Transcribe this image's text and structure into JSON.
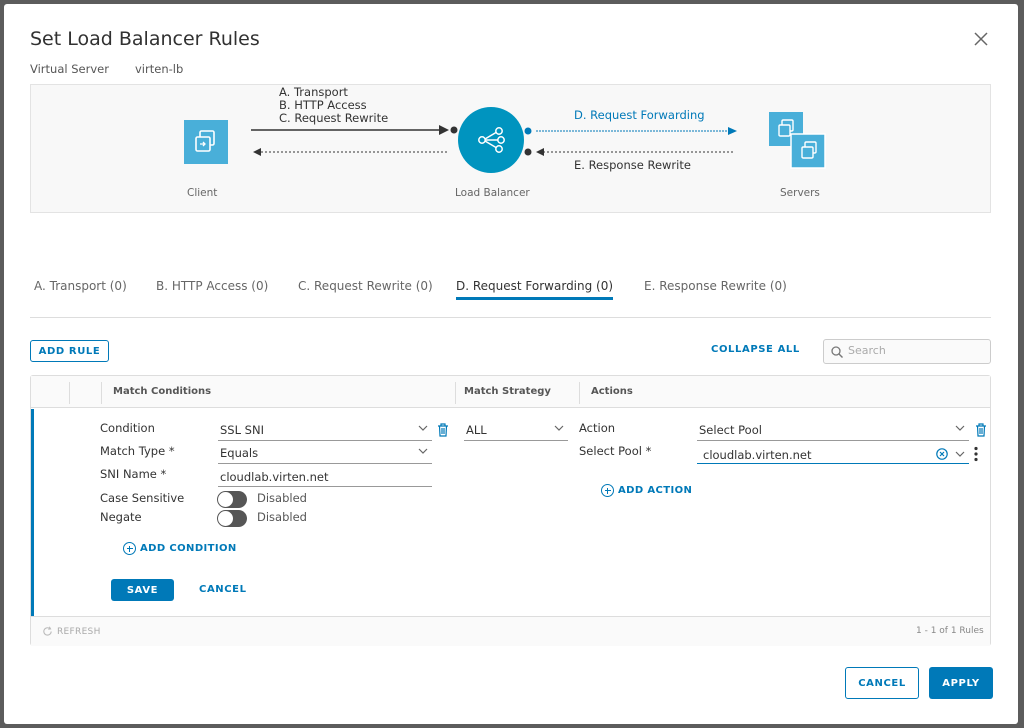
{
  "dialog": {
    "title": "Set Load Balancer Rules",
    "virtual_server_label": "Virtual Server",
    "virtual_server_value": "virten-lb"
  },
  "diagram": {
    "client_label": "Client",
    "lb_label": "Load Balancer",
    "servers_label": "Servers",
    "inbound_lines": [
      "A. Transport",
      "B. HTTP Access",
      "C. Request Rewrite"
    ],
    "forward_label": "D. Request Forwarding",
    "response_label": "E. Response Rewrite",
    "accent_color": "#0079b8",
    "icon_color": "#49afd9"
  },
  "tabs": [
    {
      "label": "A. Transport (0)",
      "active": false
    },
    {
      "label": "B. HTTP Access (0)",
      "active": false
    },
    {
      "label": "C. Request Rewrite (0)",
      "active": false
    },
    {
      "label": "D. Request Forwarding (0)",
      "active": true
    },
    {
      "label": "E. Response Rewrite (0)",
      "active": false
    }
  ],
  "toolbar": {
    "add_rule": "ADD RULE",
    "collapse_all": "COLLAPSE ALL",
    "search_placeholder": "Search"
  },
  "grid": {
    "columns": {
      "match_conditions": "Match Conditions",
      "match_strategy": "Match Strategy",
      "actions": "Actions"
    },
    "conditions": {
      "condition_label": "Condition",
      "condition_value": "SSL SNI",
      "match_type_label": "Match Type *",
      "match_type_value": "Equals",
      "sni_name_label": "SNI Name *",
      "sni_name_value": "cloudlab.virten.net",
      "case_sensitive_label": "Case Sensitive",
      "case_sensitive_value": "Disabled",
      "negate_label": "Negate",
      "negate_value": "Disabled",
      "add_condition": "ADD CONDITION"
    },
    "strategy_value": "ALL",
    "actions": {
      "action_label": "Action",
      "action_value": "Select Pool",
      "select_pool_label": "Select Pool *",
      "select_pool_value": "cloudlab.virten.net",
      "add_action": "ADD ACTION"
    },
    "save": "SAVE",
    "cancel": "CANCEL",
    "refresh": "REFRESH",
    "pagination": "1 - 1 of 1 Rules"
  },
  "footer": {
    "cancel": "CANCEL",
    "apply": "APPLY"
  }
}
